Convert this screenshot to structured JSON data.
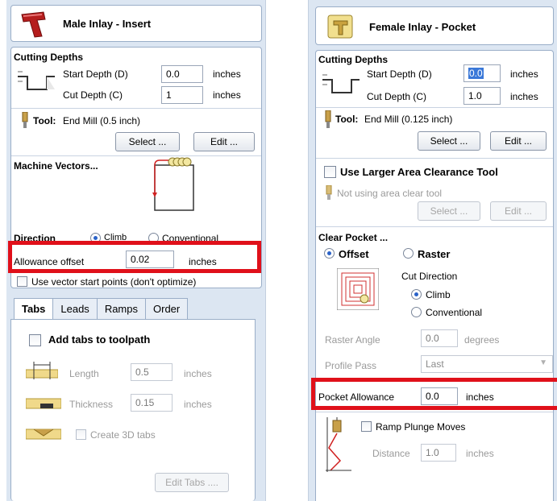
{
  "left": {
    "title": "Male Inlay - Insert",
    "cutting_depths": {
      "heading": "Cutting Depths",
      "start_label": "Start Depth (D)",
      "start_value": "0.0",
      "start_unit": "inches",
      "cut_label": "Cut Depth (C)",
      "cut_value": "1",
      "cut_unit": "inches"
    },
    "tool": {
      "label": "Tool:",
      "value": "End Mill (0.5 inch)",
      "select_btn": "Select ...",
      "edit_btn": "Edit ..."
    },
    "machine_vectors": {
      "heading": "Machine Vectors...",
      "direction_label": "Direction",
      "climb": "Climb",
      "conventional": "Conventional",
      "allowance_label": "Allowance offset",
      "allowance_value": "0.02",
      "allowance_unit": "inches",
      "vector_start": "Use vector start points (don't optimize)"
    },
    "tabs": [
      "Tabs",
      "Leads",
      "Ramps",
      "Order"
    ],
    "tabs_panel": {
      "add_tabs": "Add tabs to toolpath",
      "length_label": "Length",
      "length_value": "0.5",
      "length_unit": "inches",
      "thickness_label": "Thickness",
      "thickness_value": "0.15",
      "thickness_unit": "inches",
      "create_3d": "Create 3D tabs",
      "edit_tabs_btn": "Edit Tabs ...."
    }
  },
  "right": {
    "title": "Female Inlay - Pocket",
    "cutting_depths": {
      "heading": "Cutting Depths",
      "start_label": "Start Depth (D)",
      "start_value": "0.0",
      "start_unit": "inches",
      "cut_label": "Cut Depth (C)",
      "cut_value": "1.0",
      "cut_unit": "inches"
    },
    "tool": {
      "label": "Tool:",
      "value": "End Mill (0.125 inch)",
      "select_btn": "Select ...",
      "edit_btn": "Edit ..."
    },
    "larger_area": {
      "label": "Use Larger Area Clearance Tool",
      "not_using": "Not using area clear tool",
      "select_btn": "Select ...",
      "edit_btn": "Edit ..."
    },
    "clear_pocket": {
      "heading": "Clear Pocket ...",
      "offset": "Offset",
      "raster": "Raster",
      "cut_direction": "Cut Direction",
      "climb": "Climb",
      "conventional": "Conventional",
      "raster_angle_label": "Raster Angle",
      "raster_angle_value": "0.0",
      "raster_angle_unit": "degrees",
      "profile_pass_label": "Profile Pass",
      "profile_pass_value": "Last",
      "pocket_allowance_label": "Pocket Allowance",
      "pocket_allowance_value": "0.0",
      "pocket_allowance_unit": "inches"
    },
    "ramp": {
      "label": "Ramp Plunge Moves",
      "distance_label": "Distance",
      "distance_value": "1.0",
      "distance_unit": "inches"
    }
  },
  "colors": {
    "panel_bg": "#dce6f2",
    "highlight": "#e0101a",
    "selection": "#3a78d8"
  }
}
